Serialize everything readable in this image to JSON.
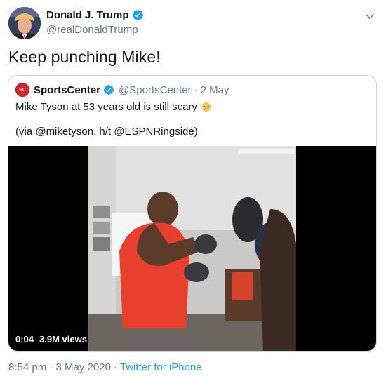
{
  "author": {
    "name": "Donald J. Trump",
    "handle": "@realDonaldTrump"
  },
  "tweet": {
    "text": "Keep punching Mike!"
  },
  "quote": {
    "logo_text": "SC",
    "name": "SportsCenter",
    "handle": "@SportsCenter",
    "dot": "·",
    "date": "2 May",
    "line1": "Mike Tyson at 53 years old is still scary",
    "line2": "(via @miketyson, h/t @ESPNRingside)",
    "video": {
      "time": "0:04",
      "views": "3.9M views"
    }
  },
  "footer": {
    "time": "8:54 pm · 3 May 2020",
    "sep": "·",
    "source": "Twitter for iPhone"
  },
  "colors": {
    "verified": "#1da1f2",
    "secondary_text": "#657786",
    "link": "#1da1f2",
    "border": "#ccd6dd"
  },
  "icons": {
    "verified": "verified-badge-icon",
    "menu": "chevron-down-icon",
    "emoji": "face-with-steam-emoji-icon"
  }
}
